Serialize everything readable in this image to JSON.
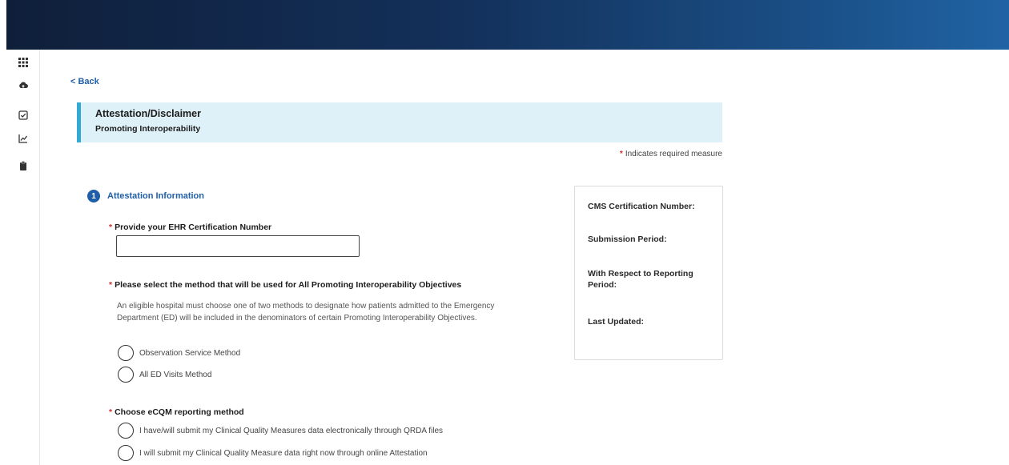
{
  "sidebar": {
    "icons": [
      "grid-icon",
      "cloud-upload-icon",
      "checkbox-icon",
      "chart-icon",
      "clipboard-icon"
    ]
  },
  "nav": {
    "back_label": "< Back"
  },
  "banner": {
    "title": "Attestation/Disclaimer",
    "subtitle": "Promoting Interoperability"
  },
  "required_note": {
    "star": "*",
    "text": "Indicates required measure"
  },
  "section": {
    "step_number": "1",
    "title": "Attestation Information"
  },
  "q1": {
    "star": "*",
    "label": "Provide your EHR Certification Number",
    "value": ""
  },
  "q2": {
    "star": "*",
    "label": "Please select the method that will be used for All Promoting Interoperability Objectives",
    "description": "An eligible hospital must choose one of two methods to designate how patients admitted to the Emergency Department (ED) will be included in the denominators of certain Promoting Interoperability Objectives.",
    "options": [
      "Observation Service Method",
      "All ED Visits Method"
    ]
  },
  "q3": {
    "star": "*",
    "label": "Choose eCQM reporting method",
    "options": [
      "I have/will submit my Clinical Quality Measures data electronically through QRDA files",
      "I will submit my Clinical Quality Measure data right now through online Attestation"
    ]
  },
  "side_panel": {
    "cms_cert": "CMS Certification Number:",
    "submission_period": "Submission Period:",
    "reporting_period": "With Respect to Reporting Period:",
    "last_updated": "Last Updated:"
  },
  "colors": {
    "accent": "#1f5ea8",
    "banner_bg": "#dff1f8",
    "banner_border": "#33a9d6",
    "required": "#d0312d"
  }
}
